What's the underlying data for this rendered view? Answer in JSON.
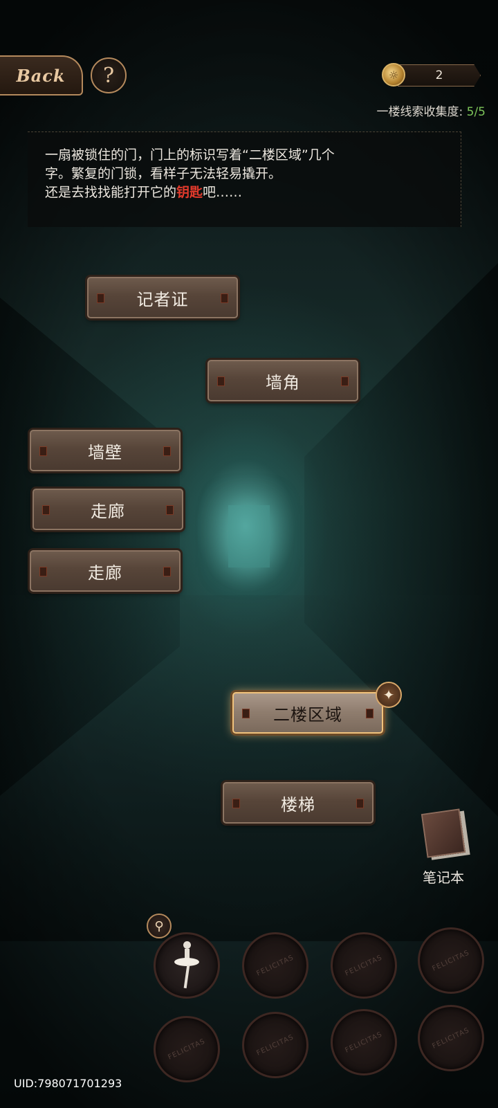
{
  "header": {
    "back_label": "Back",
    "help_symbol": "?",
    "coin_count": "2",
    "progress_label": "一楼线索收集度: ",
    "progress_value": "5/5"
  },
  "description": {
    "line1": "一扇被锁住的门，门上的标识写着“二楼区域”几个",
    "line2": "字。繁复的门锁，看样子无法轻易撬开。",
    "line3_before": "还是去找找能打开它的",
    "line3_key": "钥匙",
    "line3_after": "吧……",
    "key_color": "#e23a2c"
  },
  "clues": [
    {
      "label": "记者证"
    },
    {
      "label": "墙角"
    },
    {
      "label": "墙壁"
    },
    {
      "label": "走廊"
    },
    {
      "label": "走廊"
    },
    {
      "label": "二楼区域",
      "active": true
    },
    {
      "label": "楼梯"
    }
  ],
  "notebook": {
    "label": "笔记本"
  },
  "inventory": {
    "watermark": "FELICITAS",
    "slots": [
      {
        "item": "ballerina-figurine"
      },
      {
        "item": null
      },
      {
        "item": null
      },
      {
        "item": null
      },
      {
        "item": null
      },
      {
        "item": null
      },
      {
        "item": null
      },
      {
        "item": null
      }
    ]
  },
  "footer": {
    "uid": "UID:798071701293"
  }
}
